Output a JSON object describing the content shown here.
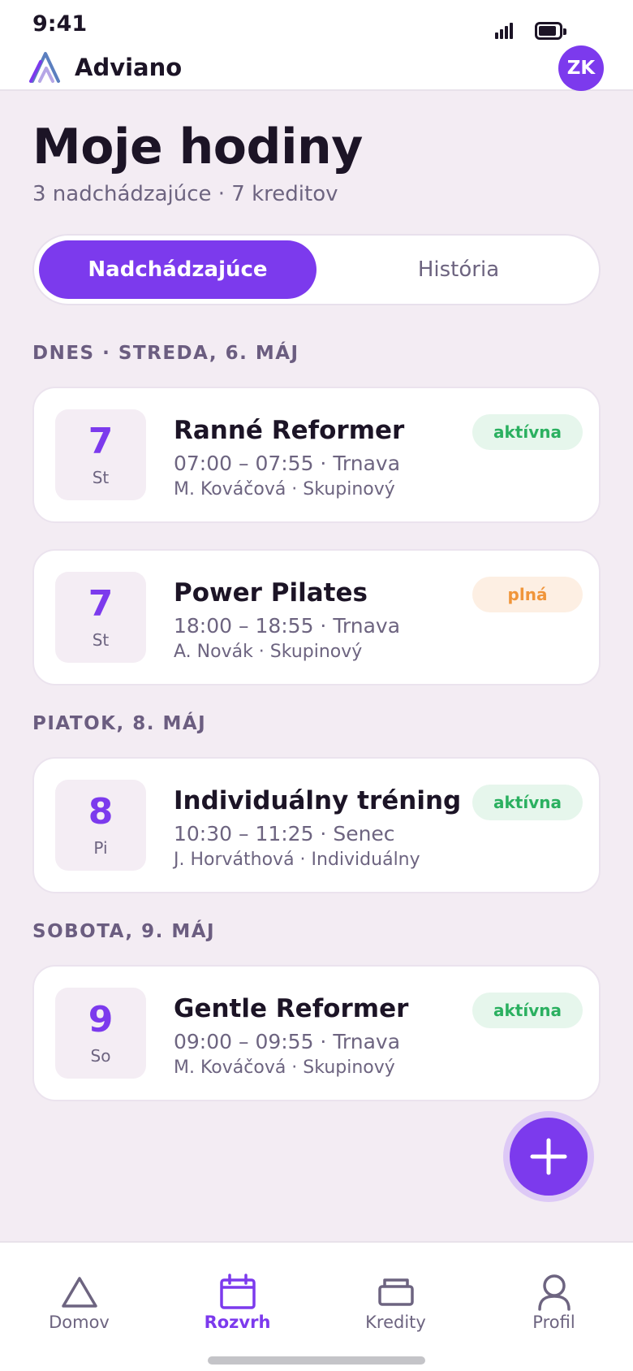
{
  "status_bar": {
    "time": "9:41"
  },
  "header": {
    "brand": "Adviano",
    "avatar_initials": "ZK"
  },
  "page": {
    "title": "Moje hodiny",
    "subtitle": "3 nadchádzajúce · 7 kreditov"
  },
  "tabs": [
    {
      "label": "Nadchádzajúce",
      "active": true
    },
    {
      "label": "História",
      "active": false
    }
  ],
  "sections": [
    {
      "label": "DNES · STREDA, 6. MÁJ",
      "classes": [
        {
          "date_num": "7",
          "date_day": "St",
          "title": "Ranné Reformer",
          "time": "07:00 – 07:55 · Trnava",
          "meta": "M. Kováčová · Skupinový",
          "status": "aktívna",
          "status_color": "#2bb060"
        },
        {
          "date_num": "7",
          "date_day": "St",
          "title": "Power Pilates",
          "time": "18:00 – 18:55 · Trnava",
          "meta": "A. Novák · Skupinový",
          "status": "plná",
          "status_color": "#f0953a"
        }
      ]
    },
    {
      "label": "PIATOK, 8. MÁJ",
      "classes": [
        {
          "date_num": "8",
          "date_day": "Pi",
          "title": "Individuálny tréning",
          "time": "10:30 – 11:25 · Senec",
          "meta": "J. Horváthová · Individuálny",
          "status": "aktívna",
          "status_color": "#2bb060"
        }
      ]
    },
    {
      "label": "SOBOTA, 9. MÁJ",
      "classes": [
        {
          "date_num": "9",
          "date_day": "So",
          "title": "Gentle Reformer",
          "time": "09:00 – 09:55 · Trnava",
          "meta": "M. Kováčová · Skupinový",
          "status": "aktívna",
          "status_color": "#2bb060"
        }
      ]
    }
  ],
  "fab": {
    "icon": "plus-icon"
  },
  "bottom_nav": [
    {
      "label": "Domov",
      "icon": "home-icon",
      "active": false
    },
    {
      "label": "Rozvrh",
      "icon": "calendar-icon",
      "active": true
    },
    {
      "label": "Kredity",
      "icon": "wallet-icon",
      "active": false
    },
    {
      "label": "Profil",
      "icon": "user-icon",
      "active": false
    }
  ],
  "colors": {
    "accent": "#7c3aed",
    "background": "#f3ecf3",
    "success": "#2bb060",
    "warning": "#f0953a"
  }
}
